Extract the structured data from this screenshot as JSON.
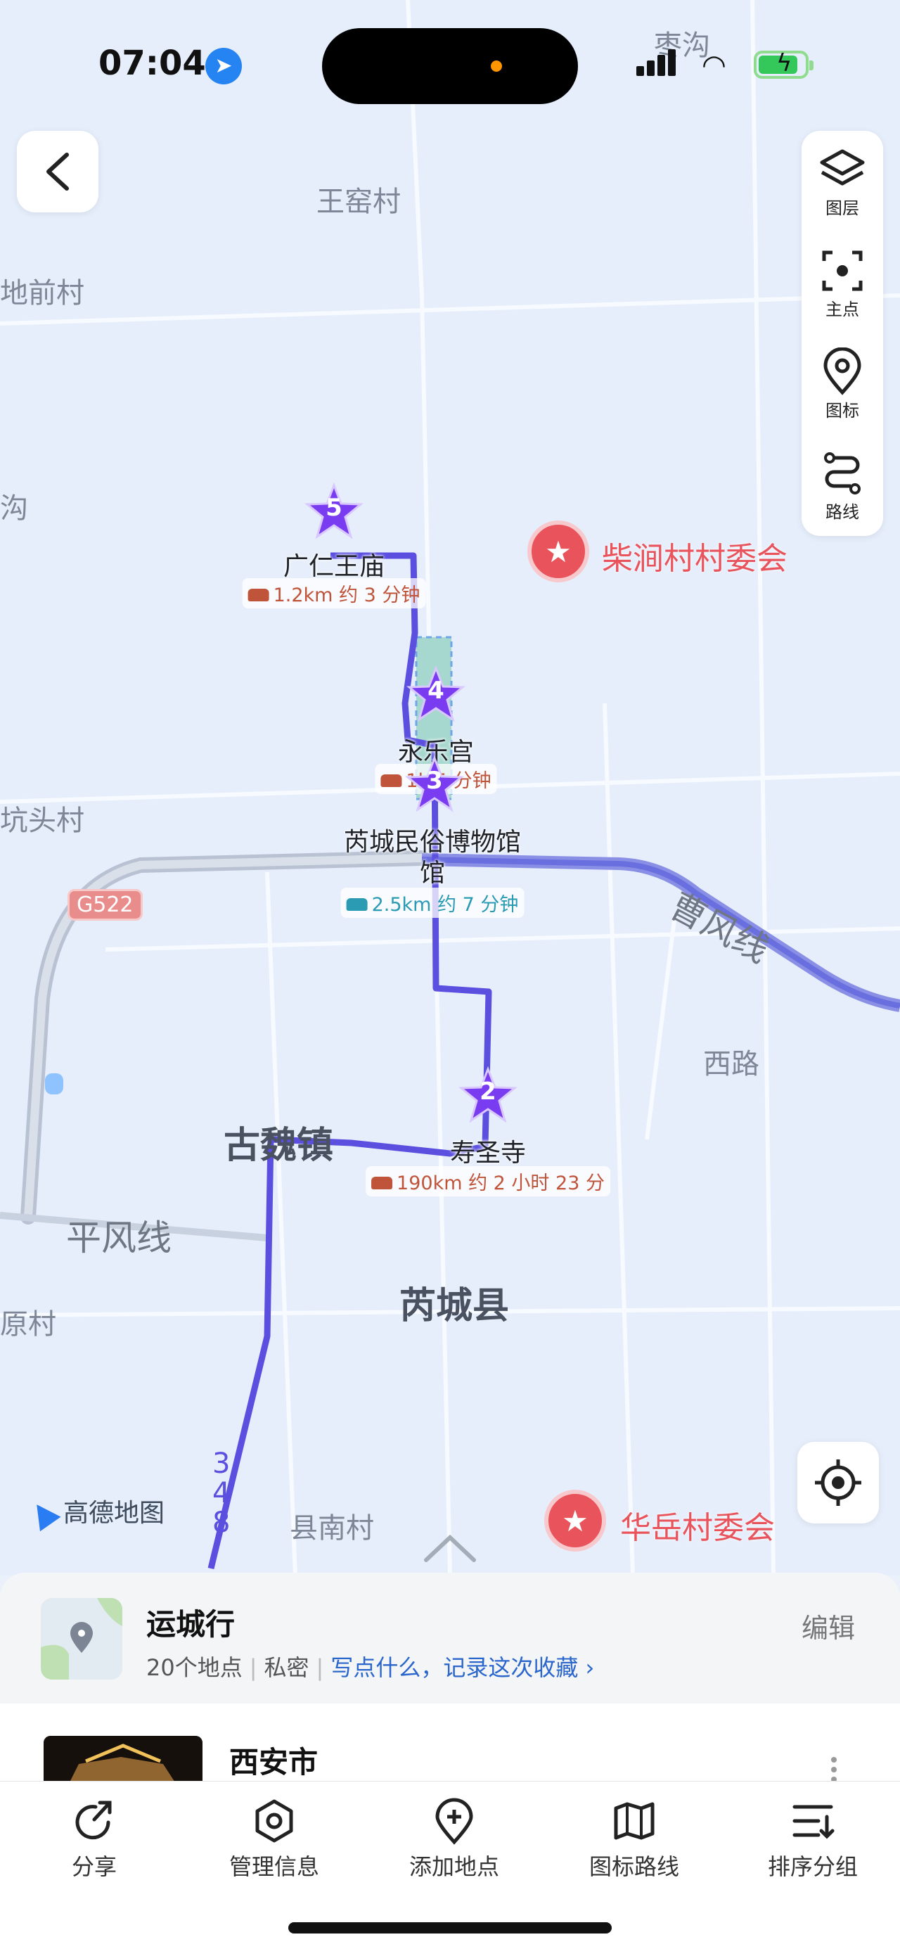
{
  "status_bar": {
    "time": "07:04",
    "colors": {
      "battery": "#34c759",
      "location": "#2584f2"
    }
  },
  "map": {
    "village_labels": [
      "枣沟",
      "王窑村",
      "地前村",
      "沟",
      "坑头村",
      "西路",
      "原村",
      "县南村"
    ],
    "town_labels": [
      "古魏镇",
      "芮城县"
    ],
    "road_labels": [
      "平风线",
      "曹风线",
      "G522",
      "348"
    ],
    "route_stops": [
      {
        "number": "5",
        "name": "广仁王庙",
        "distance": "1.2km 约 3 分钟"
      },
      {
        "number": "4",
        "name": "永乐宫",
        "distance": "1k   5 分钟"
      },
      {
        "number": "3",
        "name": "芮城民俗博物馆",
        "name_line2": "馆",
        "distance": "2.5km 约 7 分钟"
      },
      {
        "number": "2",
        "name": "寿圣寺",
        "distance": "190km 约 2 小时 23 分"
      }
    ],
    "pois": [
      "柴涧村村委会",
      "华岳村委会"
    ],
    "logo": "高德地图",
    "colors": {
      "route": "#5b4fe0",
      "star": "#7a3cf0",
      "poi": "#e9545c"
    }
  },
  "toolbar": [
    {
      "label": "图层",
      "icon": "layers-icon"
    },
    {
      "label": "主点",
      "icon": "focus-icon"
    },
    {
      "label": "图标",
      "icon": "pin-icon"
    },
    {
      "label": "路线",
      "icon": "route-icon"
    }
  ],
  "collection": {
    "title": "运城行",
    "count": "20个地点",
    "privacy": "私密",
    "prompt": "写点什么，记录这次收藏",
    "edit": "编辑"
  },
  "place": {
    "title": "西安市"
  },
  "tabbar": [
    {
      "label": "分享",
      "icon": "share-icon"
    },
    {
      "label": "管理信息",
      "icon": "manage-icon"
    },
    {
      "label": "添加地点",
      "icon": "add-location-icon"
    },
    {
      "label": "图标路线",
      "icon": "map-route-icon"
    },
    {
      "label": "排序分组",
      "icon": "sort-icon"
    }
  ]
}
